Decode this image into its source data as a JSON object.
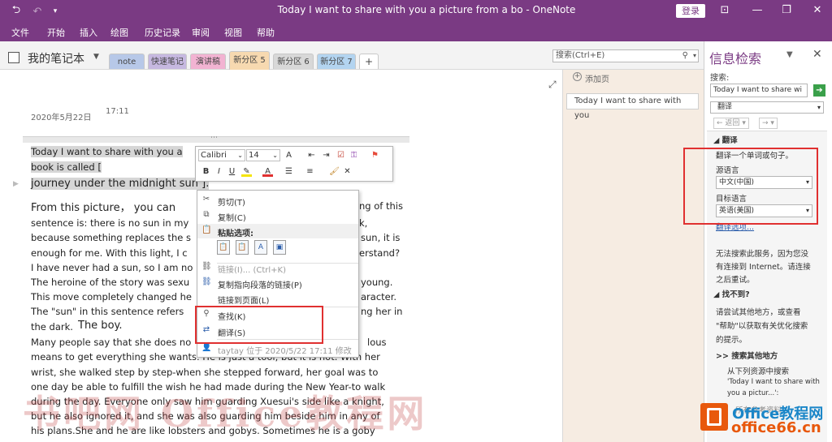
{
  "window": {
    "title": "Today I want to share with you a picture from a bo  -  OneNote",
    "login_label": "登录"
  },
  "menu": [
    "文件",
    "开始",
    "插入",
    "绘图",
    "历史记录",
    "审阅",
    "视图",
    "帮助"
  ],
  "notebook": {
    "name": "我的笔记本",
    "sections": [
      {
        "label": "note",
        "color": "#b7c8e8"
      },
      {
        "label": "快速笔记",
        "color": "#c6b8e0"
      },
      {
        "label": "演讲稿",
        "color": "#f2b3d2"
      },
      {
        "label": "新分区 5",
        "color": "#f7d9b0"
      },
      {
        "label": "新分区 6",
        "color": "#d8d8d8"
      },
      {
        "label": "新分区 7",
        "color": "#b3d4f0"
      },
      {
        "label": "+",
        "color": "#ffffff"
      }
    ],
    "search_placeholder": "搜索(Ctrl+E)"
  },
  "page": {
    "date": "2020年5月22日",
    "time": "17:11",
    "lines": [
      "Today I want to share with you a",
      "book is called [",
      "journey under the midnight sun ].",
      "From this picture， you can",
      "ng of this",
      "sentence is: there is no sun in my",
      "k,",
      "because something replaces the s",
      "sun, it is",
      "enough for me. With this light, I c",
      "erstand?",
      "I have never had a sun, so I am no",
      "The heroine of the story was sexu",
      "young.",
      "This move completely changed he",
      "aracter.",
      "The \"sun\" in this sentence refers",
      "ng her in",
      "the dark.",
      "The boy.",
      "Many people say that she does no",
      "lous",
      "means to get everything she wants. He is just a tool, but it is not. With her",
      "wrist, she walked step by step-when she stepped forward, her goal was to",
      "one day be able to fulfill the wish he had made during the New Year-to walk",
      "during the day. Everyone only saw him guarding Xuesui's side like a knight,",
      "but he also ignored it, and she was also guarding him beside him in any of",
      "his plans.She and he are like lobsters and gobys. Sometimes he is a goby"
    ],
    "watermark": "书吧网 Office教程网"
  },
  "mini_toolbar": {
    "font": "Calibri",
    "size": "14",
    "buttons": [
      "B",
      "I",
      "U"
    ]
  },
  "context_menu": {
    "cut": "剪切(T)",
    "copy": "复制(C)",
    "paste_heading": "粘贴选项:",
    "link": "链接(I)... (Ctrl+K)",
    "copy_link": "复制指向段落的链接(P)",
    "link_page": "链接到页面(L)",
    "find": "查找(K)",
    "translate": "翻译(S)",
    "author": "taytay 位于 2020/5/22 17:11 修改"
  },
  "pages": {
    "add_page": "添加页",
    "items": [
      "Today I want to share with you"
    ]
  },
  "research": {
    "title": "信息检索",
    "search_label": "搜索:",
    "search_value": "Today I want to share wi",
    "service": "翻译",
    "back": "返回",
    "section_title": "翻译",
    "desc": "翻译一个单词或句子。",
    "source_label": "源语言",
    "source_value": "中文(中国)",
    "target_label": "目标语言",
    "target_value": "英语(美国)",
    "options_link": "翻译选项...",
    "error_lines": [
      "无法搜索此服务，因为您没",
      "有连接到 Internet。请连接",
      "之后重试。"
    ],
    "not_found": "找不到?",
    "suggest_lines": [
      "请尝试其他地方，或查看",
      "\"帮助\"以获取有关优化搜索",
      "的提示。"
    ],
    "other_places": ">> 搜索其他地方",
    "from_lines": [
      "从下列资源中搜索",
      "'Today I want to share with",
      "you a pictur...':"
    ],
    "partial": "所有参考资料"
  },
  "logo": {
    "line1": "Office教程网",
    "line2": "office66.cn"
  },
  "colors": {
    "titlebar": "#7a3a83",
    "highlight_box": "#e03030",
    "selection": "#d6d6d6"
  }
}
